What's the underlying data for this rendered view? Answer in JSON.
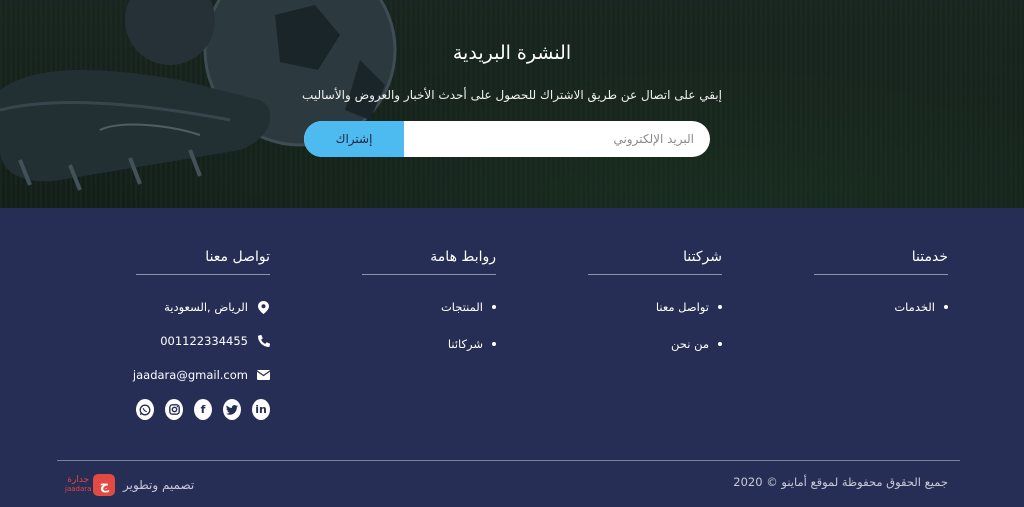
{
  "newsletter": {
    "title": "النشرة البريدية",
    "subtitle": "إبقي على اتصال عن طريق الاشتراك للحصول على أحدث الأخبار والعروض والأساليب",
    "email_placeholder": "البريد الإلكتروني",
    "subscribe_label": "إشتراك"
  },
  "footer": {
    "services": {
      "heading": "خدمتنا",
      "items": [
        "الخدمات"
      ]
    },
    "company": {
      "heading": "شركتنا",
      "items": [
        "تواصل معنا",
        "من نحن"
      ]
    },
    "links": {
      "heading": "روابط هامة",
      "items": [
        "المنتجات",
        "شركائنا"
      ]
    },
    "contact": {
      "heading": "تواصل معنا",
      "address": "الرياض ,السعودية",
      "phone": "001122334455",
      "email": "jaadara@gmail.com"
    },
    "social": [
      "linkedin-icon",
      "twitter-icon",
      "facebook-icon",
      "instagram-icon",
      "whatsapp-icon"
    ],
    "copyright": "جميع الحقوق محفوظة لموقع أماينو © 2020",
    "credit_text": "تصميم وتطوير",
    "credit_logo": {
      "mark": "ج",
      "name": "جدارة",
      "sub": "jaadara"
    }
  },
  "colors": {
    "footer_bg": "#262e55",
    "accent": "#4dbbf0",
    "brand": "#e24a43"
  }
}
